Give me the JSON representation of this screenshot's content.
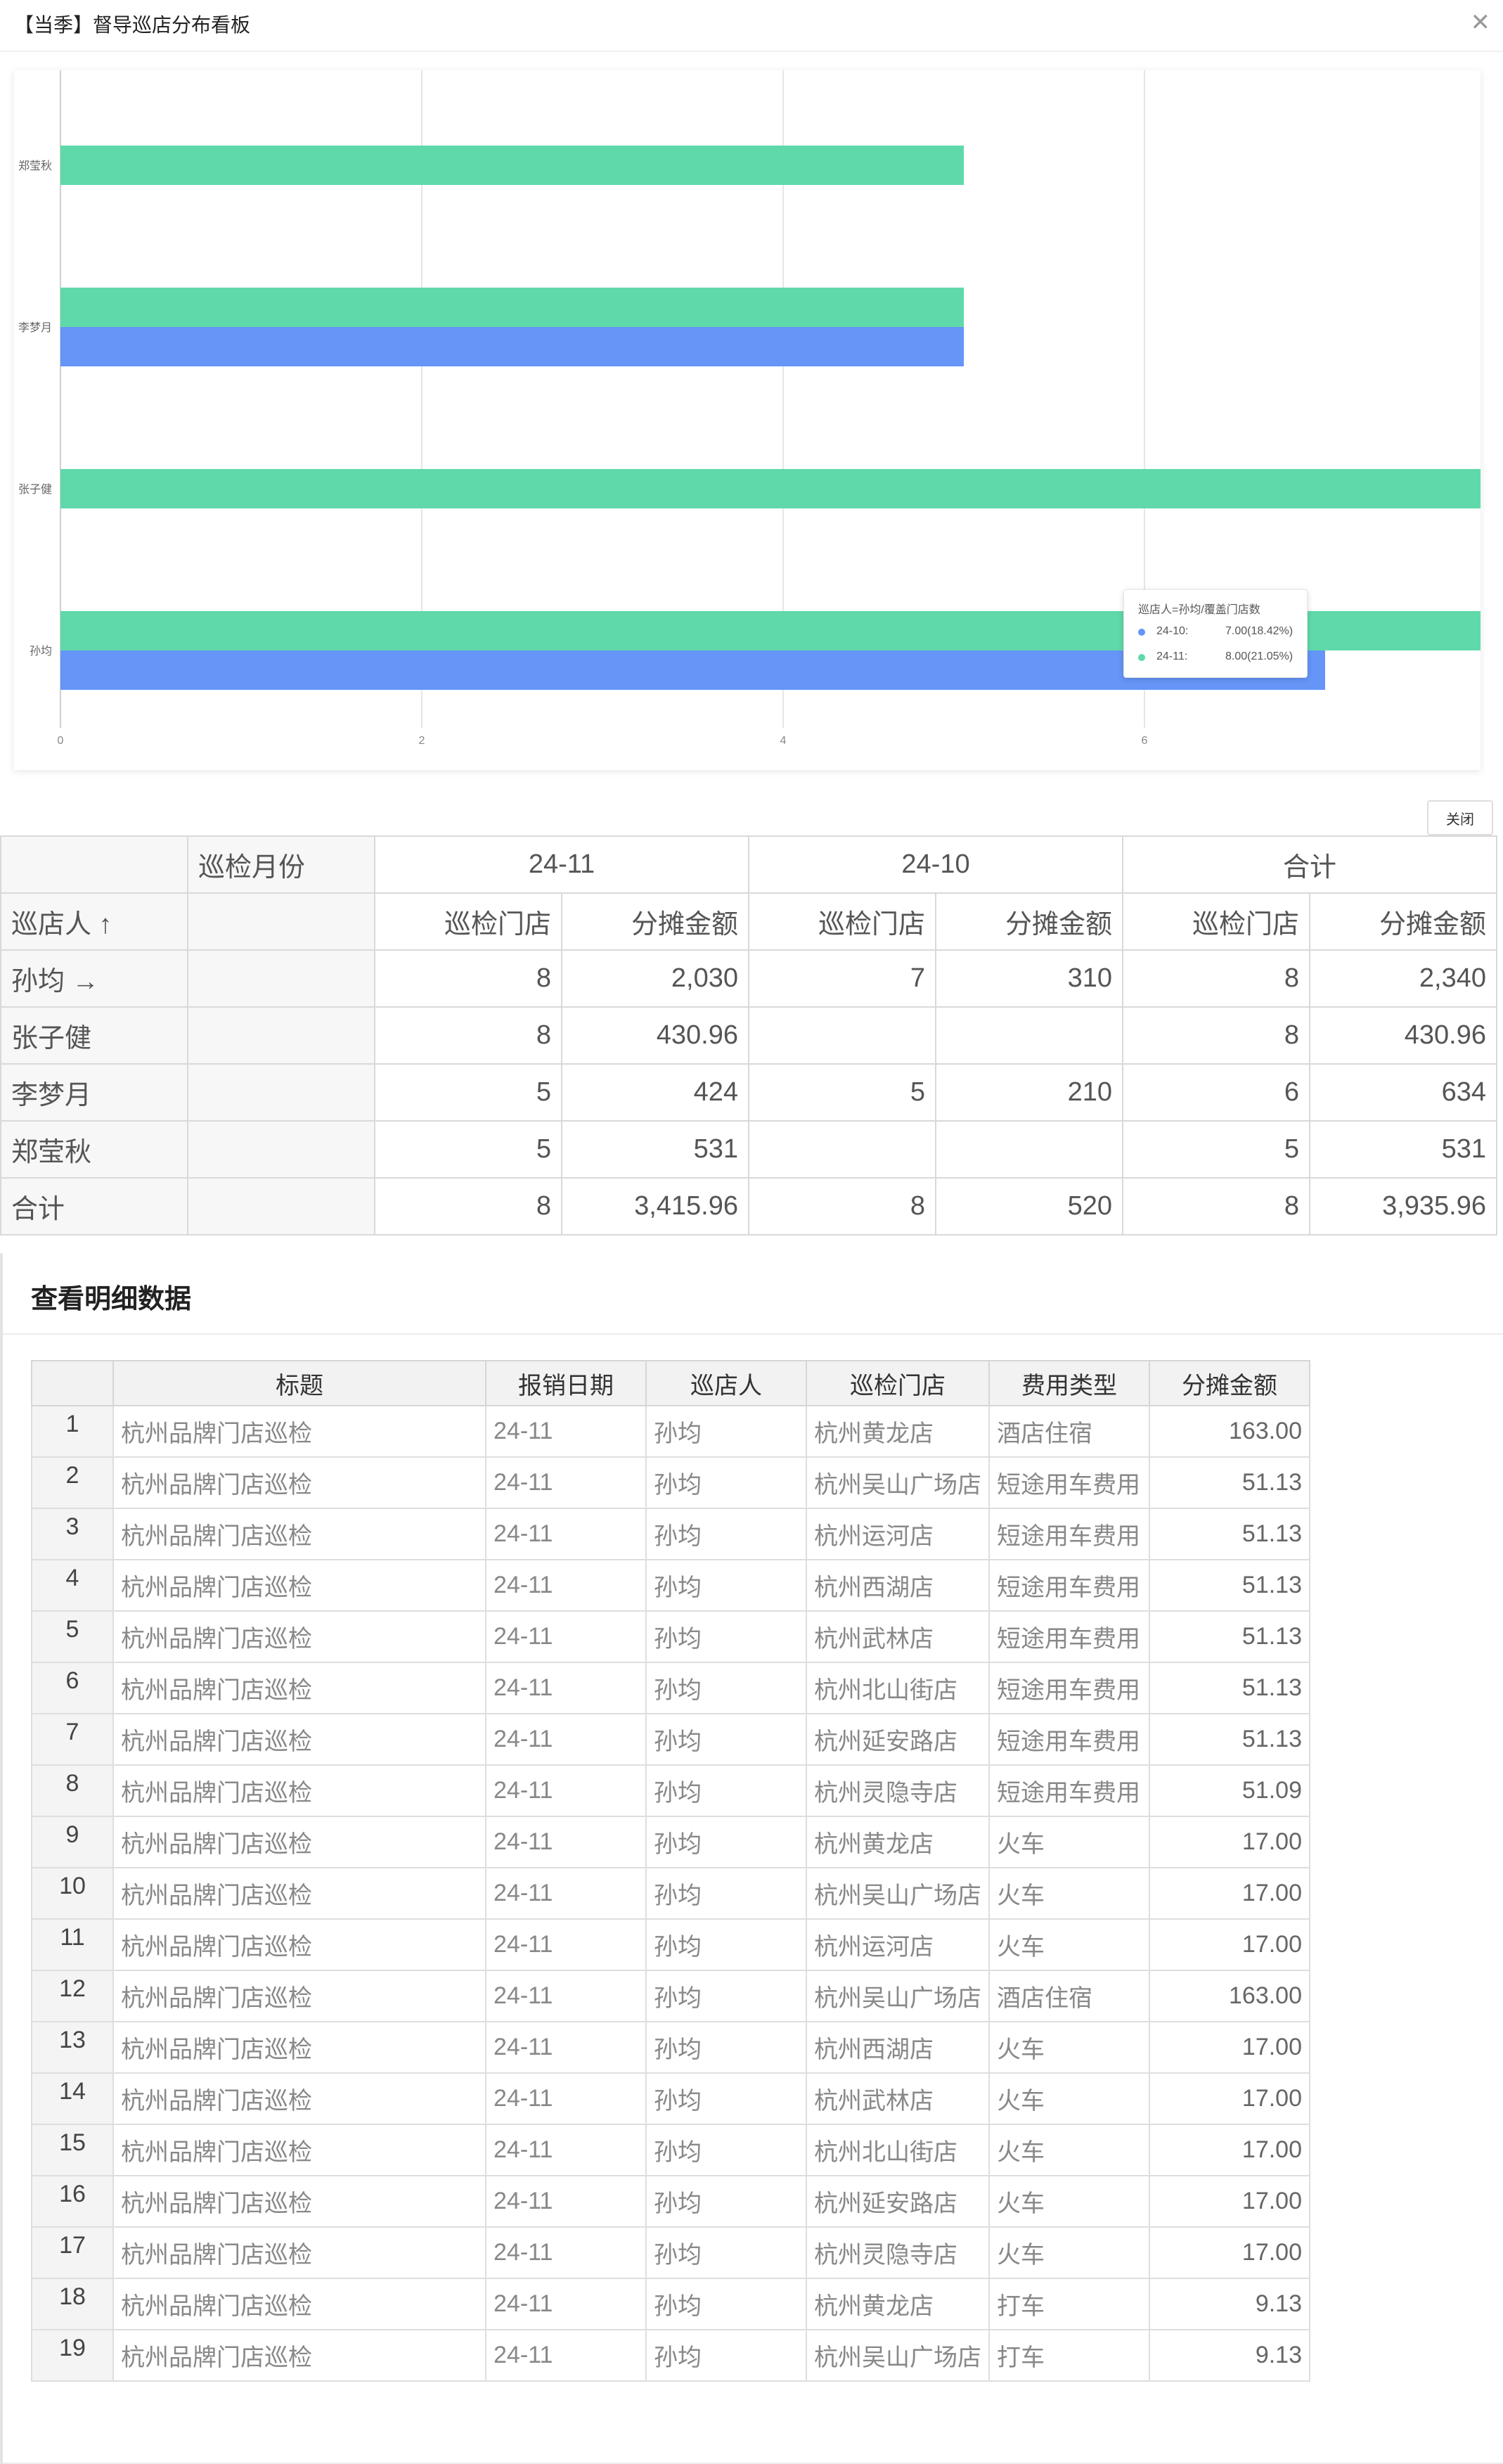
{
  "modal": {
    "title": "【当季】督导巡店分布看板",
    "close_icon": "close-icon"
  },
  "chart_data": {
    "type": "bar",
    "orientation": "horizontal",
    "categories": [
      "郑莹秋",
      "李梦月",
      "张子健",
      "孙均"
    ],
    "series": [
      {
        "name": "24-10",
        "color": "#6495f7",
        "values": [
          null,
          5,
          null,
          7
        ]
      },
      {
        "name": "24-11",
        "color": "#5fd9a9",
        "values": [
          5,
          5,
          8,
          8
        ]
      }
    ],
    "xticks": [
      "0",
      "2",
      "4",
      "6"
    ],
    "xlim": [
      0,
      7.8
    ],
    "grid": true,
    "tooltip": {
      "title": "巡店人=孙均/覆盖门店数",
      "rows": [
        {
          "name": "24-10:",
          "value": "7.00(18.42%)",
          "color": "#6495f7"
        },
        {
          "name": "24-11:",
          "value": "8.00(21.05%)",
          "color": "#5fd9a9"
        }
      ]
    }
  },
  "close_button": {
    "label": "关闭"
  },
  "pivot": {
    "corner_label": "巡检月份",
    "months": [
      "24-11",
      "24-10",
      "合计"
    ],
    "row_header": "巡店人 ↑",
    "sub_headers": [
      "巡检门店",
      "分摊金额",
      "巡检门店",
      "分摊金额",
      "巡检门店",
      "分摊金额"
    ],
    "rows": [
      {
        "name": "孙均 →",
        "cells": [
          "8",
          "2,030",
          "7",
          "310",
          "8",
          "2,340"
        ]
      },
      {
        "name": "张子健",
        "cells": [
          "8",
          "430.96",
          "",
          "",
          "8",
          "430.96"
        ]
      },
      {
        "name": "李梦月",
        "cells": [
          "5",
          "424",
          "5",
          "210",
          "6",
          "634"
        ]
      },
      {
        "name": "郑莹秋",
        "cells": [
          "5",
          "531",
          "",
          "",
          "5",
          "531"
        ]
      },
      {
        "name": "合计",
        "cells": [
          "8",
          "3,415.96",
          "8",
          "520",
          "8",
          "3,935.96"
        ]
      }
    ]
  },
  "detail": {
    "title": "查看明细数据",
    "columns": [
      "标题",
      "报销日期",
      "巡店人",
      "巡检门店",
      "费用类型",
      "分摊金额"
    ],
    "rows": [
      [
        "1",
        "杭州品牌门店巡检",
        "24-11",
        "孙均",
        "杭州黄龙店",
        "酒店住宿",
        "163.00"
      ],
      [
        "2",
        "杭州品牌门店巡检",
        "24-11",
        "孙均",
        "杭州吴山广场店",
        "短途用车费用",
        "51.13"
      ],
      [
        "3",
        "杭州品牌门店巡检",
        "24-11",
        "孙均",
        "杭州运河店",
        "短途用车费用",
        "51.13"
      ],
      [
        "4",
        "杭州品牌门店巡检",
        "24-11",
        "孙均",
        "杭州西湖店",
        "短途用车费用",
        "51.13"
      ],
      [
        "5",
        "杭州品牌门店巡检",
        "24-11",
        "孙均",
        "杭州武林店",
        "短途用车费用",
        "51.13"
      ],
      [
        "6",
        "杭州品牌门店巡检",
        "24-11",
        "孙均",
        "杭州北山街店",
        "短途用车费用",
        "51.13"
      ],
      [
        "7",
        "杭州品牌门店巡检",
        "24-11",
        "孙均",
        "杭州延安路店",
        "短途用车费用",
        "51.13"
      ],
      [
        "8",
        "杭州品牌门店巡检",
        "24-11",
        "孙均",
        "杭州灵隐寺店",
        "短途用车费用",
        "51.09"
      ],
      [
        "9",
        "杭州品牌门店巡检",
        "24-11",
        "孙均",
        "杭州黄龙店",
        "火车",
        "17.00"
      ],
      [
        "10",
        "杭州品牌门店巡检",
        "24-11",
        "孙均",
        "杭州吴山广场店",
        "火车",
        "17.00"
      ],
      [
        "11",
        "杭州品牌门店巡检",
        "24-11",
        "孙均",
        "杭州运河店",
        "火车",
        "17.00"
      ],
      [
        "12",
        "杭州品牌门店巡检",
        "24-11",
        "孙均",
        "杭州吴山广场店",
        "酒店住宿",
        "163.00"
      ],
      [
        "13",
        "杭州品牌门店巡检",
        "24-11",
        "孙均",
        "杭州西湖店",
        "火车",
        "17.00"
      ],
      [
        "14",
        "杭州品牌门店巡检",
        "24-11",
        "孙均",
        "杭州武林店",
        "火车",
        "17.00"
      ],
      [
        "15",
        "杭州品牌门店巡检",
        "24-11",
        "孙均",
        "杭州北山街店",
        "火车",
        "17.00"
      ],
      [
        "16",
        "杭州品牌门店巡检",
        "24-11",
        "孙均",
        "杭州延安路店",
        "火车",
        "17.00"
      ],
      [
        "17",
        "杭州品牌门店巡检",
        "24-11",
        "孙均",
        "杭州灵隐寺店",
        "火车",
        "17.00"
      ],
      [
        "18",
        "杭州品牌门店巡检",
        "24-11",
        "孙均",
        "杭州黄龙店",
        "打车",
        "9.13"
      ],
      [
        "19",
        "杭州品牌门店巡检",
        "24-11",
        "孙均",
        "杭州吴山广场店",
        "打车",
        "9.13"
      ]
    ]
  }
}
